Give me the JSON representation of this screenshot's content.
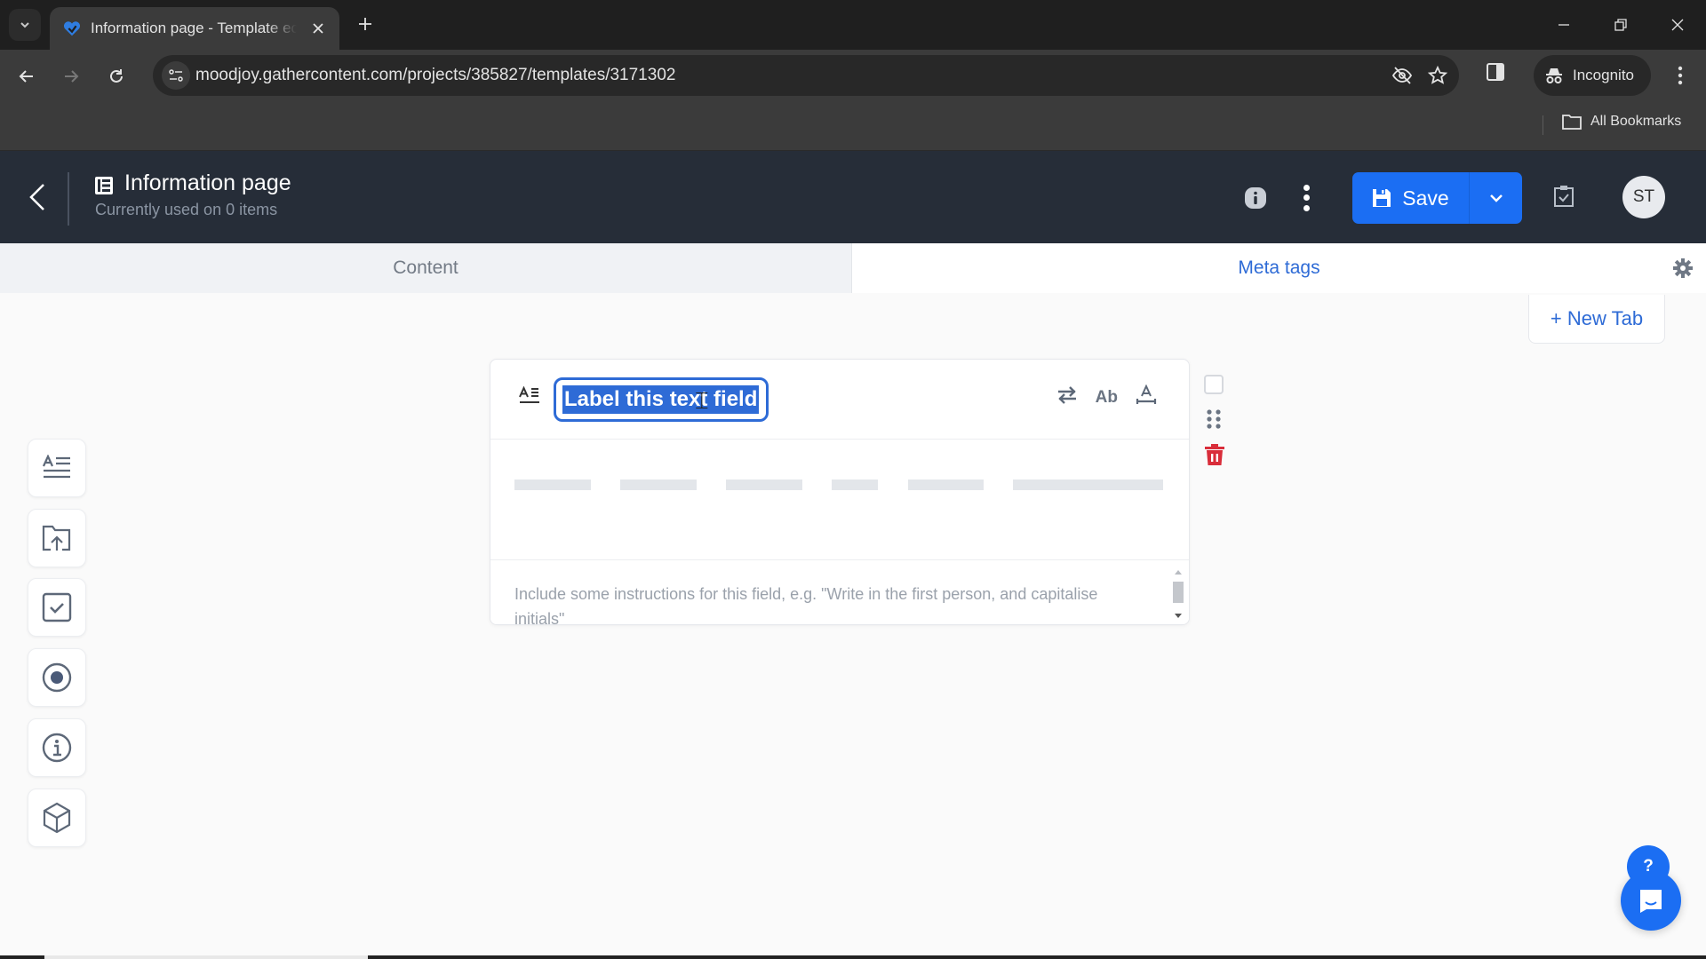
{
  "browser": {
    "tab_title": "Information page - Template editor",
    "tab_title_visible": "Information page - Template ec",
    "url_host": "moodjoy.gathercontent.com",
    "url_path": "/projects/385827/templates/3171302",
    "incognito_label": "Incognito",
    "all_bookmarks_label": "All Bookmarks"
  },
  "header": {
    "title": "Information page",
    "subtitle": "Currently used on 0 items",
    "save_label": "Save",
    "avatar_initials": "ST"
  },
  "tabs": [
    {
      "label": "Content",
      "active": false
    },
    {
      "label": "Meta tags",
      "active": true
    }
  ],
  "new_tab_label": "+ New Tab",
  "field": {
    "label_value": "Label this text field",
    "format_label": "Ab",
    "instructions_placeholder": "Include some instructions for this field, e.g. \"Write in the first person, and capitalise initials\""
  },
  "sidebar": {
    "items": [
      {
        "name": "text-field",
        "icon": "text-field-icon"
      },
      {
        "name": "attachment-field",
        "icon": "folder-upload-icon"
      },
      {
        "name": "checkbox-field",
        "icon": "checkbox-icon"
      },
      {
        "name": "radio-field",
        "icon": "radio-icon"
      },
      {
        "name": "guidelines-field",
        "icon": "info-icon"
      },
      {
        "name": "component-field",
        "icon": "cube-icon"
      }
    ]
  },
  "help": {
    "help_label": "?"
  },
  "colors": {
    "accent": "#1b6ef3",
    "link": "#2e6bd6",
    "header_bg": "#262d38",
    "danger": "#d92d3a"
  }
}
